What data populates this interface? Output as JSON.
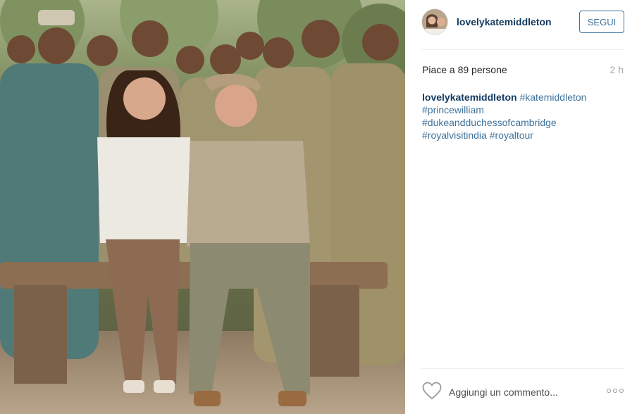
{
  "post": {
    "username": "lovelykatemiddleton",
    "follow_label": "SEGUI",
    "likes_text": "Piace a 89 persone",
    "time_text": "2 h",
    "caption": {
      "user": "lovelykatemiddleton",
      "tags": [
        "#katemiddleton",
        "#princewilliam",
        "#dukeandduchessofcambridge",
        "#royalvisitindia",
        "#royaltour"
      ]
    },
    "comment_placeholder": "Aggiungi un commento...",
    "icons": {
      "like": "heart-icon",
      "more": "more-options-icon"
    }
  },
  "colors": {
    "link": "#3f729b",
    "username": "#12395e",
    "muted": "#a5a7aa"
  }
}
